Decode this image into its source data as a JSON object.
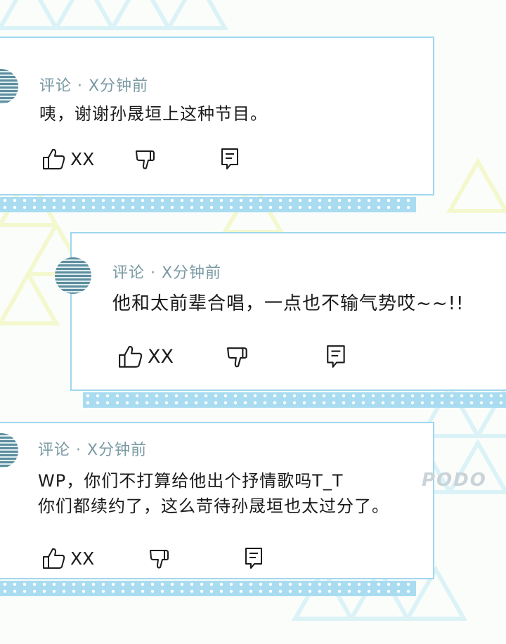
{
  "comments": [
    {
      "meta": "评论 · X分钟前",
      "lines": [
        "咦，谢谢孙晟垣上这种节目。"
      ],
      "likes": "XX"
    },
    {
      "meta": "评论 · X分钟前",
      "lines": [
        "他和太前辈合唱，一点也不输气势哎~~!!"
      ],
      "likes": "XX"
    },
    {
      "meta": "评论 · X分钟前",
      "lines": [
        "WP，你们不打算给他出个抒情歌吗T_T",
        "你们都续约了，这么苛待孙晟垣也太过分了。"
      ],
      "likes": "XX"
    }
  ],
  "watermark": "PODO",
  "icons": [
    "like-icon",
    "dislike-icon",
    "reply-icon"
  ],
  "colors": {
    "border": "#9fd6ee",
    "tape": "#a9dcf1",
    "meta": "#7a9aa4",
    "avatar": "#5e8f9e"
  }
}
